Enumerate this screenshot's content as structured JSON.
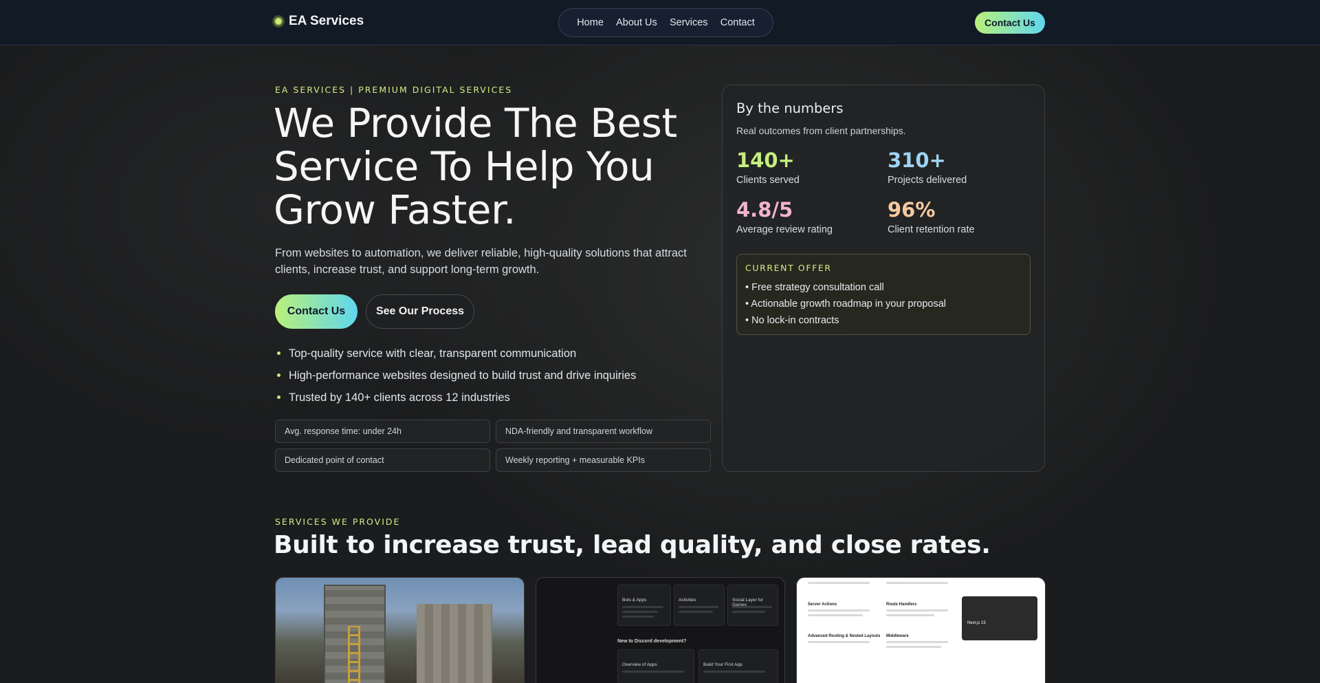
{
  "header": {
    "brand": "EA Services",
    "nav": [
      "Home",
      "About Us",
      "Services",
      "Contact"
    ],
    "cta": "Contact Us"
  },
  "hero": {
    "eyebrow": "EA SERVICES | PREMIUM DIGITAL SERVICES",
    "title": "We Provide The Best Service To Help You Grow Faster.",
    "subtitle": "From websites to automation, we deliver reliable, high-quality solutions that attract clients, increase trust, and support long-term growth.",
    "primary_cta": "Contact Us",
    "secondary_cta": "See Our Process",
    "bullets": [
      "Top-quality service with clear, transparent communication",
      "High-performance websites designed to build trust and drive inquiries",
      "Trusted by 140+ clients across 12 industries"
    ],
    "chips": [
      "Avg. response time: under 24h",
      "NDA-friendly and transparent workflow",
      "Dedicated point of contact",
      "Weekly reporting + measurable KPIs"
    ]
  },
  "stats": {
    "title": "By the numbers",
    "subtitle": "Real outcomes from client partnerships.",
    "items": [
      {
        "value": "140+",
        "label": "Clients served",
        "color": "#c4ef7e"
      },
      {
        "value": "310+",
        "label": "Projects delivered",
        "color": "#9ed4f2"
      },
      {
        "value": "4.8/5",
        "label": "Average review rating",
        "color": "#f2b3cf"
      },
      {
        "value": "96%",
        "label": "Client retention rate",
        "color": "#f5c9a0"
      }
    ],
    "offer": {
      "title": "CURRENT OFFER",
      "items": [
        "• Free strategy consultation call",
        "• Actionable growth roadmap in your proposal",
        "• No lock-in contracts"
      ]
    }
  },
  "services": {
    "eyebrow": "SERVICES WE PROVIDE",
    "title": "Built to increase trust, lead quality, and close rates.",
    "discord_preview": {
      "cards": [
        "Bots & Apps",
        "Activities",
        "Social Layer for Games"
      ],
      "section": "New to Discord development?",
      "bottom_cards": [
        "Overview of Apps",
        "Build Your First App"
      ]
    },
    "next_preview": {
      "cards": [
        "Server Actions",
        "Route Handlers",
        "Advanced Routing & Nested Layouts",
        "Middleware"
      ],
      "feature": "Next.js 15"
    }
  },
  "colors": {
    "accent_lime": "#c6ec7a",
    "accent_cyan": "#5fd6ee",
    "header_bg": "#121a26"
  }
}
